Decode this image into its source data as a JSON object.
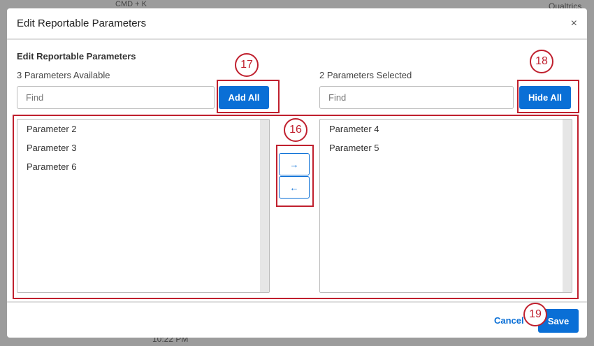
{
  "background": {
    "shortcut": "CMD + K",
    "brand": "Qualtrics",
    "time": "10:22 PM"
  },
  "modal": {
    "title": "Edit Reportable Parameters",
    "close": "×",
    "section_title": "Edit Reportable Parameters",
    "available": {
      "label": "3 Parameters Available",
      "placeholder": "Find",
      "button": "Add All",
      "items": [
        "Parameter 2",
        "Parameter 3",
        "Parameter 6"
      ]
    },
    "selected": {
      "label": "2 Parameters Selected",
      "placeholder": "Find",
      "button": "Hide All",
      "items": [
        "Parameter 4",
        "Parameter 5"
      ]
    },
    "move_right": "→",
    "move_left": "←",
    "cancel": "Cancel",
    "save": "Save"
  },
  "callouts": [
    "16",
    "17",
    "18",
    "19"
  ]
}
